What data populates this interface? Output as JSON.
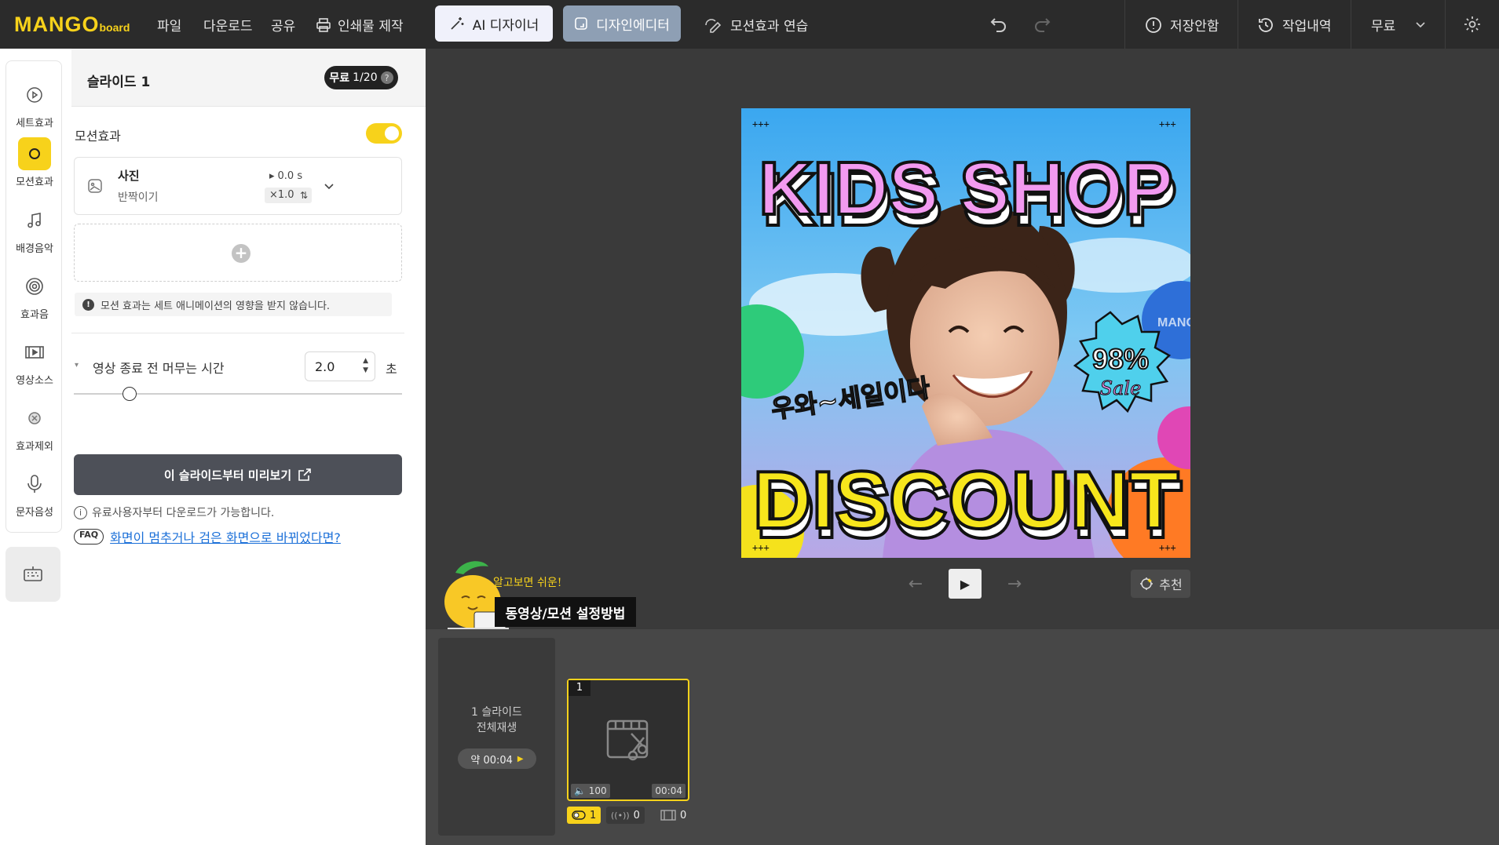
{
  "app": {
    "logo_main": "MANGO",
    "logo_sub": "board",
    "brand_color": "#f7d21b"
  },
  "topbar": {
    "menu": [
      "파일",
      "다운로드",
      "공유"
    ],
    "print_label": "인쇄물 제작",
    "ai_designer_label": "AI 디자이너",
    "design_editor_label": "디자인에디터",
    "motion_practice_label": "모션효과 연습",
    "unsaved_label": "저장안함",
    "history_label": "작업내역",
    "plan_label": "무료"
  },
  "iconbar": {
    "items": [
      {
        "label": "세트효과",
        "icon": "gear-play-icon"
      },
      {
        "label": "모션효과",
        "icon": "circle-icon"
      },
      {
        "label": "배경음악",
        "icon": "music-note-icon"
      },
      {
        "label": "효과음",
        "icon": "target-icon"
      },
      {
        "label": "영상소스",
        "icon": "film-icon"
      },
      {
        "label": "효과제외",
        "icon": "exclude-icon"
      },
      {
        "label": "문자음성",
        "icon": "microphone-icon"
      }
    ]
  },
  "panel": {
    "slide_title": "슬라이드 1",
    "free_badge": "무료",
    "free_count": "1/20",
    "motion_label": "모션효과",
    "motion_enabled": true,
    "effect": {
      "title": "사진",
      "subtitle": "반짝이기",
      "delay": "0.0 s",
      "speed": "×1.0"
    },
    "notice": "모션 효과는 세트 애니메이션의 영향을 받지 않습니다.",
    "hold_label": "영상 종료 전 머무는 시간",
    "hold_value": "2.0",
    "hold_unit": "초",
    "hold_slider_fraction": 0.14,
    "preview_label": "이 슬라이드부터 미리보기",
    "info_text": "유료사용자부터 다운로드가 가능합니다.",
    "faq_badge": "FAQ",
    "faq_link": "화면이 멈추거나 검은 화면으로 바뀌었다면?"
  },
  "poster": {
    "headline_top": "KIDS SHOP",
    "headline_bottom": "DISCOUNT",
    "korean_line": "우와~세일이다",
    "badge_percent": "98%",
    "badge_sale": "Sale",
    "watermark": "MANG"
  },
  "stage": {
    "recommend_label": "추천",
    "help_note": "알고보면 쉬운!",
    "help_title": "동영상/모션 설정방법"
  },
  "timeline": {
    "all_play_line1": "1 슬라이드",
    "all_play_line2": "전체재생",
    "all_play_duration": "약 00:04",
    "slide_number": "1",
    "slide_volume": "100",
    "slide_duration": "00:04",
    "motion_count": "1",
    "sound_count": "0",
    "video_count": "0"
  }
}
